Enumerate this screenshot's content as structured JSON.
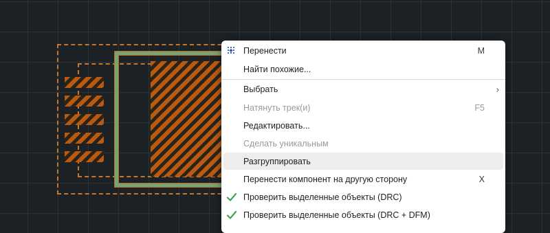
{
  "context_menu": {
    "items": [
      {
        "label": "Перенести",
        "shortcut": "M",
        "icon": "move-crosshair-icon"
      },
      {
        "label": "Найти похожие..."
      },
      {
        "label": "Выбрать",
        "submenu": "›"
      },
      {
        "label": "Натянуть трек(и)",
        "shortcut": "F5",
        "disabled": true
      },
      {
        "label": "Редактировать..."
      },
      {
        "label": "Сделать уникальным",
        "disabled": true
      },
      {
        "label": "Разгруппировать",
        "highlighted": true
      },
      {
        "label": "Перенести компонент на другую сторону",
        "shortcut": "X"
      },
      {
        "label": "Проверить выделенные объекты (DRC)",
        "icon": "checkmark-icon"
      },
      {
        "label": "Проверить выделенные объекты (DRC + DFM)",
        "icon": "checkmark-icon"
      }
    ]
  },
  "colors": {
    "canvas_bg": "#1c2126",
    "copper": "#b85a12",
    "selection_dashed": "#c8762a",
    "outline_green": "#7aa372",
    "checkmark": "#3aa655",
    "move_icon": "#3a6fd8"
  }
}
